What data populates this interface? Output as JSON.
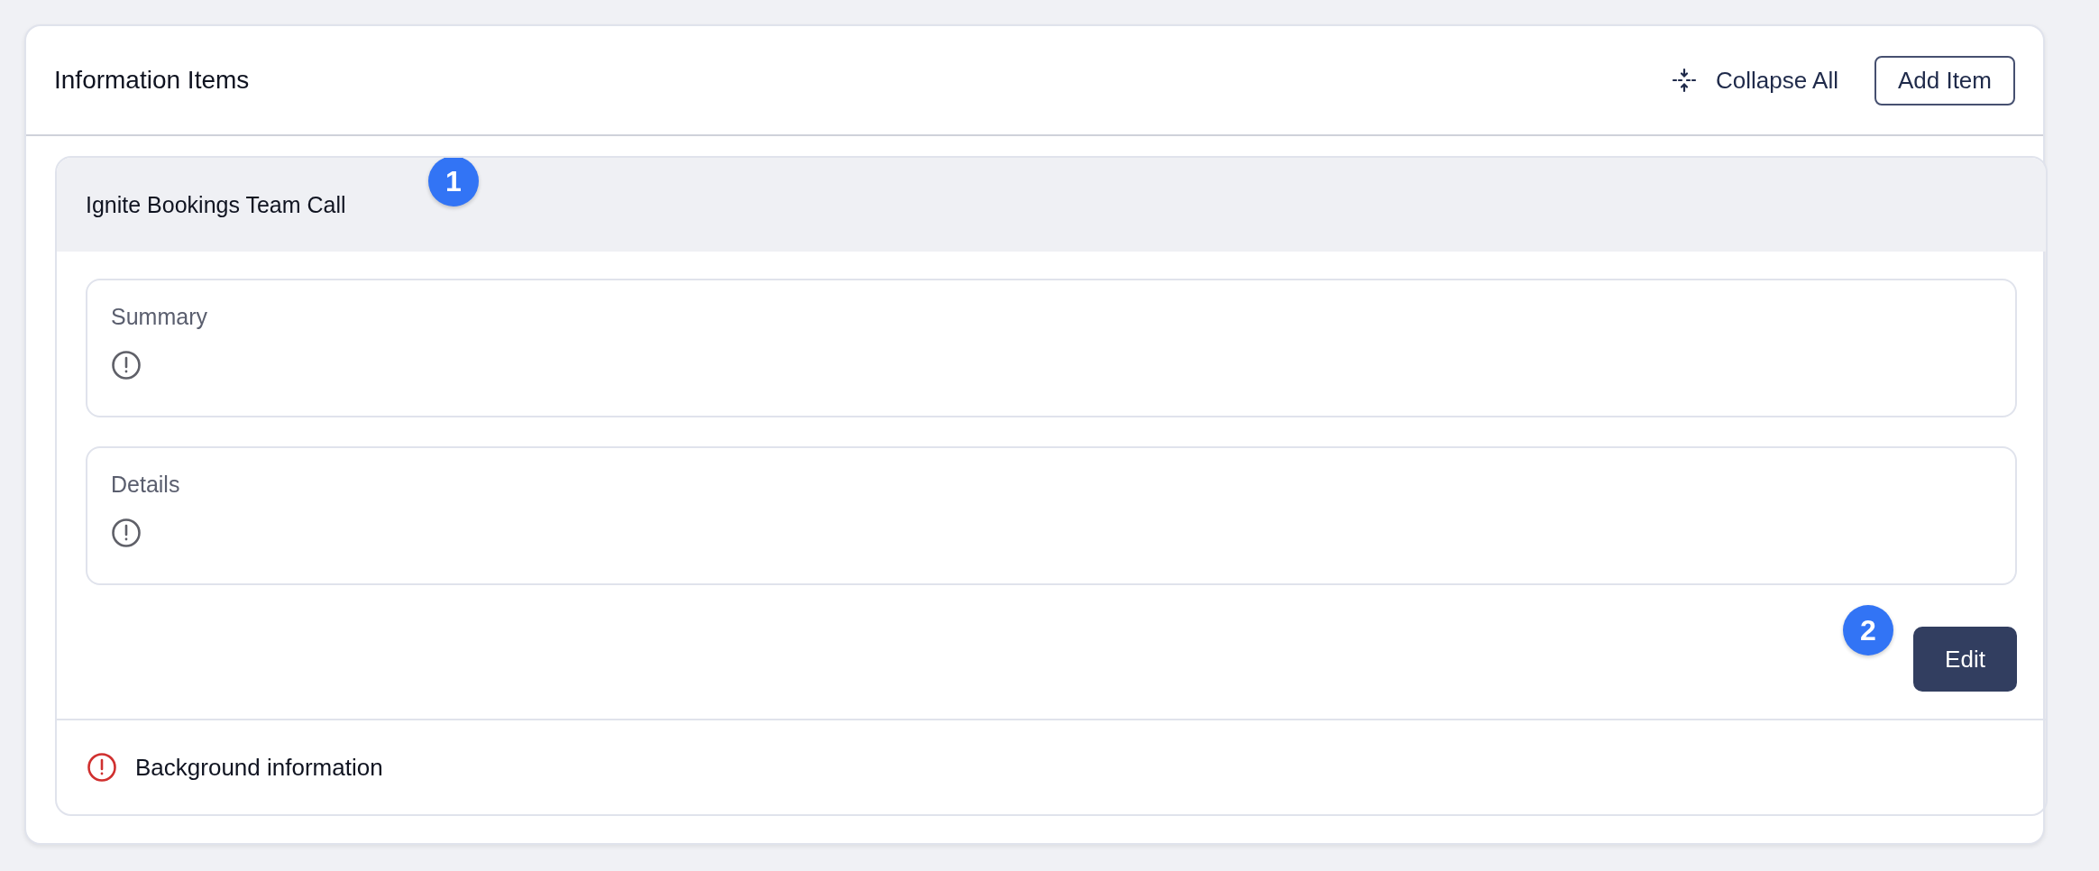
{
  "panel": {
    "title": "Information Items",
    "collapse_all": "Collapse All",
    "add_item": "Add Item"
  },
  "items": [
    {
      "title": "Ignite Bookings Team Call",
      "expanded": true,
      "badge": "1",
      "fields": [
        {
          "label": "Summary"
        },
        {
          "label": "Details"
        }
      ],
      "action": {
        "label": "Edit",
        "badge": "2"
      }
    },
    {
      "title": "Background information",
      "expanded": false
    }
  ]
}
